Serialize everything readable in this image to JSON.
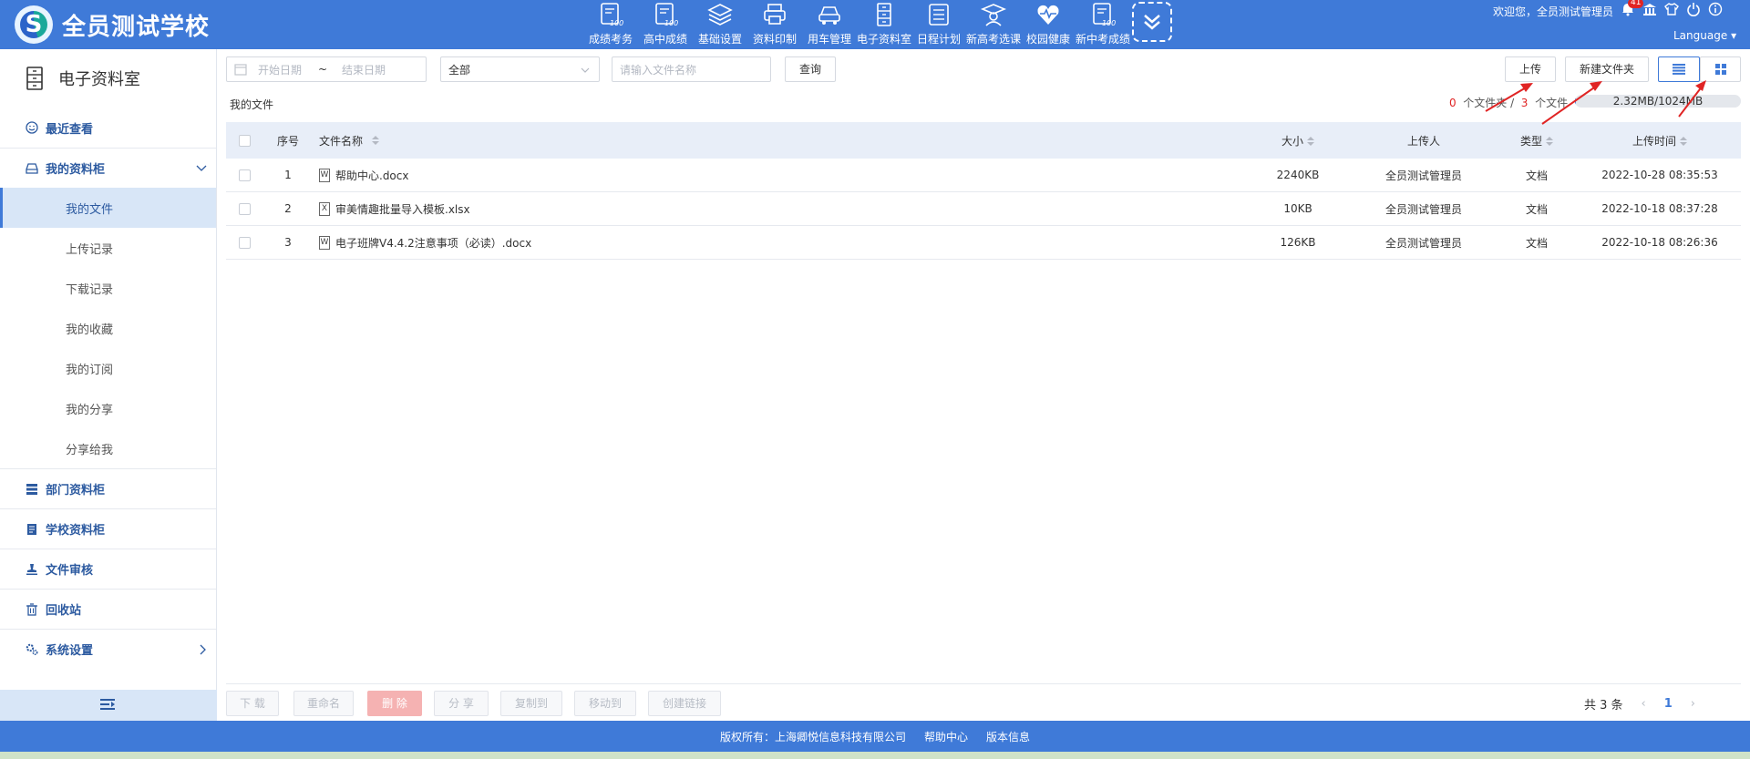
{
  "header": {
    "school_name": "全员测试学校",
    "nav": [
      {
        "label": "成绩考务",
        "icon": "score-exam-icon"
      },
      {
        "label": "高中成绩",
        "icon": "high-school-score-icon"
      },
      {
        "label": "基础设置",
        "icon": "layers-icon"
      },
      {
        "label": "资料印制",
        "icon": "printer-icon"
      },
      {
        "label": "用车管理",
        "icon": "car-icon"
      },
      {
        "label": "电子资料室",
        "icon": "cabinet-icon"
      },
      {
        "label": "日程计划",
        "icon": "calendar-list-icon"
      },
      {
        "label": "新高考选课",
        "icon": "graduate-icon"
      },
      {
        "label": "校园健康",
        "icon": "heart-pulse-icon"
      },
      {
        "label": "新中考成绩",
        "icon": "new-exam-score-icon"
      }
    ],
    "welcome": "欢迎您，全员测试管理员",
    "notification_count": "41",
    "language": "Language"
  },
  "sidebar": {
    "title": "电子资料室",
    "groups": {
      "recent": "最近查看",
      "my_cabinet": "我的资料柜",
      "dept": "部门资料柜",
      "school": "学校资料柜",
      "audit": "文件审核",
      "recycle": "回收站",
      "settings": "系统设置"
    },
    "sub_items": [
      "我的文件",
      "上传记录",
      "下载记录",
      "我的收藏",
      "我的订阅",
      "我的分享",
      "分享给我"
    ]
  },
  "toolbar": {
    "start_date_placeholder": "开始日期",
    "date_sep": "~",
    "end_date_placeholder": "结束日期",
    "type_select": "全部",
    "search_placeholder": "请输入文件名称",
    "query": "查询",
    "upload": "上传",
    "new_folder": "新建文件夹"
  },
  "breadcrumb": "我的文件",
  "stats": {
    "folders": "0",
    "folders_label": "个文件夹 /",
    "files": "3",
    "files_label": "个文件",
    "quota": "2.32MB/1024MB",
    "quota_fraction": 0.00227
  },
  "table": {
    "headers": {
      "no": "序号",
      "name": "文件名称",
      "size": "大小",
      "uploader": "上传人",
      "type": "类型",
      "time": "上传时间"
    },
    "rows": [
      {
        "no": "1",
        "name": "帮助中心.docx",
        "kind": "W",
        "size": "2240KB",
        "uploader": "全员测试管理员",
        "type": "文档",
        "time": "2022-10-28 08:35:53"
      },
      {
        "no": "2",
        "name": "审美情趣批量导入模板.xlsx",
        "kind": "X",
        "size": "10KB",
        "uploader": "全员测试管理员",
        "type": "文档",
        "time": "2022-10-18 08:37:28"
      },
      {
        "no": "3",
        "name": "电子班牌V4.4.2注意事项（必读）.docx",
        "kind": "W",
        "size": "126KB",
        "uploader": "全员测试管理员",
        "type": "文档",
        "time": "2022-10-18 08:26:36"
      }
    ]
  },
  "actions": {
    "download": "下 载",
    "rename": "重命名",
    "delete": "删 除",
    "share": "分 享",
    "copy_to": "复制到",
    "move_to": "移动到",
    "create_link": "创建链接"
  },
  "pager": {
    "total": "共 3 条",
    "current": "1"
  },
  "footer": {
    "copyright": "版权所有：上海卿悦信息科技有限公司",
    "help": "帮助中心",
    "version": "版本信息"
  },
  "colors": {
    "primary": "#3f7ad8",
    "danger": "#f5b2b2",
    "annotation": "#e02424"
  }
}
